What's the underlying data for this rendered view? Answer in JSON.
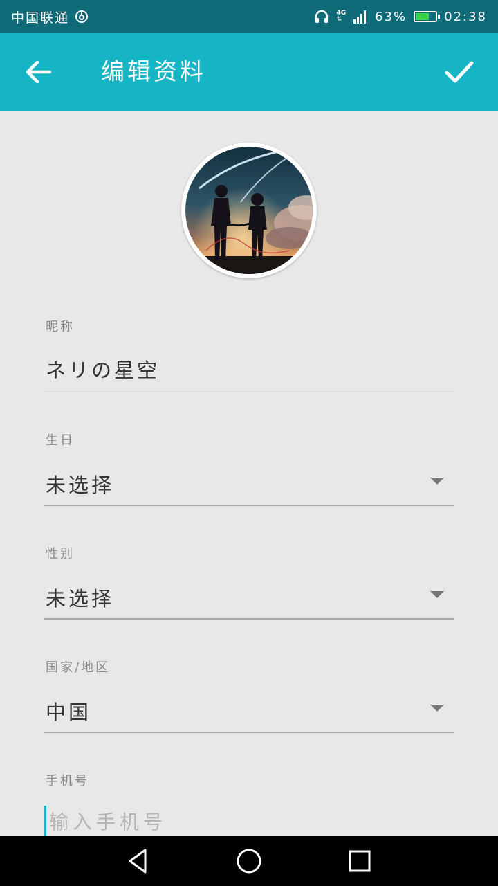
{
  "status_bar": {
    "carrier": "中国联通",
    "network_type": "4G",
    "battery_percent": "63%",
    "battery_level": 0.63,
    "time": "02:38",
    "icons": [
      "carrier-icon",
      "headphones-icon",
      "signal-icon",
      "battery-icon"
    ]
  },
  "app_bar": {
    "title": "编辑资料",
    "background_color": "#16b5c6",
    "icons": [
      "back-arrow-icon",
      "checkmark-icon"
    ]
  },
  "profile": {
    "avatar": "profile-photo"
  },
  "fields": {
    "nickname": {
      "label": "昵称",
      "value": "ネリの星空"
    },
    "birthday": {
      "label": "生日",
      "value": "未选择"
    },
    "gender": {
      "label": "性别",
      "value": "未选择"
    },
    "region": {
      "label": "国家/地区",
      "value": "中国"
    },
    "phone": {
      "label": "手机号",
      "value": "",
      "placeholder": "输入手机号"
    }
  },
  "nav_bar": {
    "icons": [
      "back-triangle-icon",
      "home-circle-icon",
      "recents-square-icon"
    ]
  }
}
